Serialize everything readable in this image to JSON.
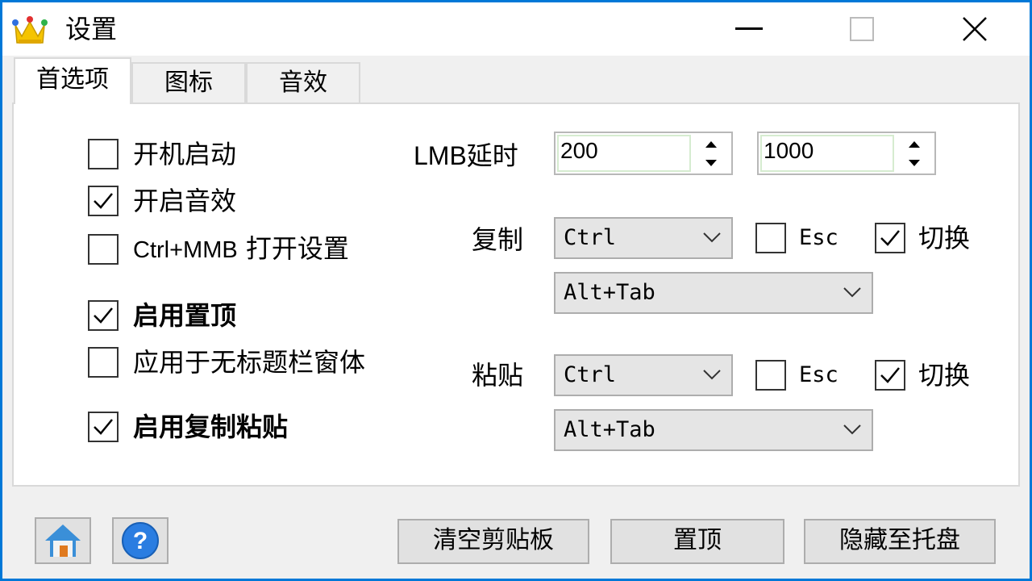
{
  "window": {
    "title": "设置",
    "app_icon": "crown-icon",
    "controls": [
      "minimize-icon",
      "maximize-icon",
      "close-icon"
    ]
  },
  "tabs": [
    {
      "label": "首选项",
      "active": true
    },
    {
      "label": "图标",
      "active": false
    },
    {
      "label": "音效",
      "active": false
    }
  ],
  "options": {
    "autostart": {
      "label": "开机启动",
      "checked": false
    },
    "sound": {
      "label": "开启音效",
      "checked": true
    },
    "ctrl_mmb_prefix": "Ctrl+MMB",
    "ctrl_mmb_suffix": " 打开设置",
    "ctrl_mmb_checked": false,
    "pin": {
      "label": "启用置顶",
      "checked": true
    },
    "apply_titleless": {
      "label": "应用于无标题栏窗体",
      "checked": false
    },
    "copy_paste": {
      "label": "启用复制粘贴",
      "checked": true
    }
  },
  "lmb": {
    "label": "LMB延时",
    "value1": "200",
    "value2": "1000"
  },
  "copy": {
    "label": "复制",
    "modifier": "Ctrl",
    "esc_label": "Esc",
    "esc_checked": false,
    "toggle_label": "切换",
    "toggle_checked": true,
    "hotkey": "Alt+Tab"
  },
  "paste": {
    "label": "粘贴",
    "modifier": "Ctrl",
    "esc_label": "Esc",
    "esc_checked": false,
    "toggle_label": "切换",
    "toggle_checked": true,
    "hotkey": "Alt+Tab"
  },
  "footer": {
    "home_icon": "home-icon",
    "help_icon": "help-icon",
    "clear_label": "清空剪贴板",
    "pin_label": "置顶",
    "hide_label": "隐藏至托盘"
  }
}
